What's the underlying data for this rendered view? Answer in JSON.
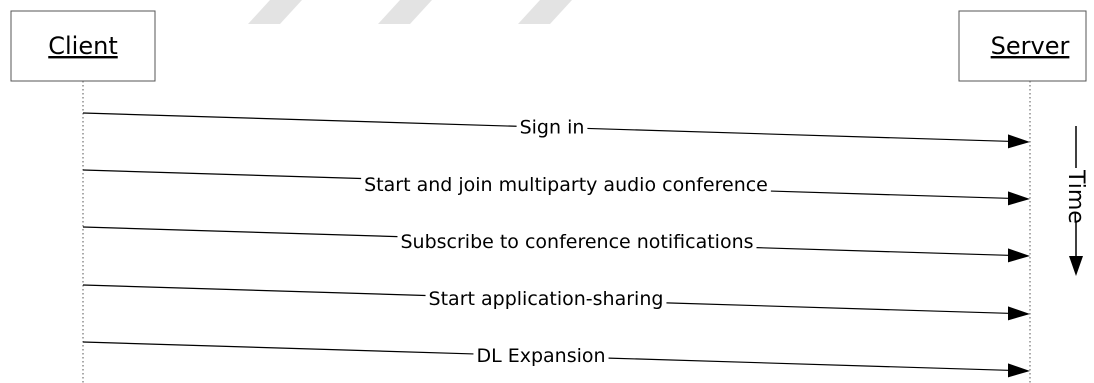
{
  "actors": {
    "client": "Client",
    "server": "Server"
  },
  "messages": [
    {
      "label": "Sign in",
      "from": "client",
      "to": "server"
    },
    {
      "label": "Start and join multiparty audio conference",
      "from": "client",
      "to": "server"
    },
    {
      "label": "Subscribe to conference notifications",
      "from": "client",
      "to": "server"
    },
    {
      "label": "Start application-sharing",
      "from": "client",
      "to": "server"
    },
    {
      "label": "DL Expansion",
      "from": "client",
      "to": "server"
    }
  ],
  "time_label": "Time"
}
